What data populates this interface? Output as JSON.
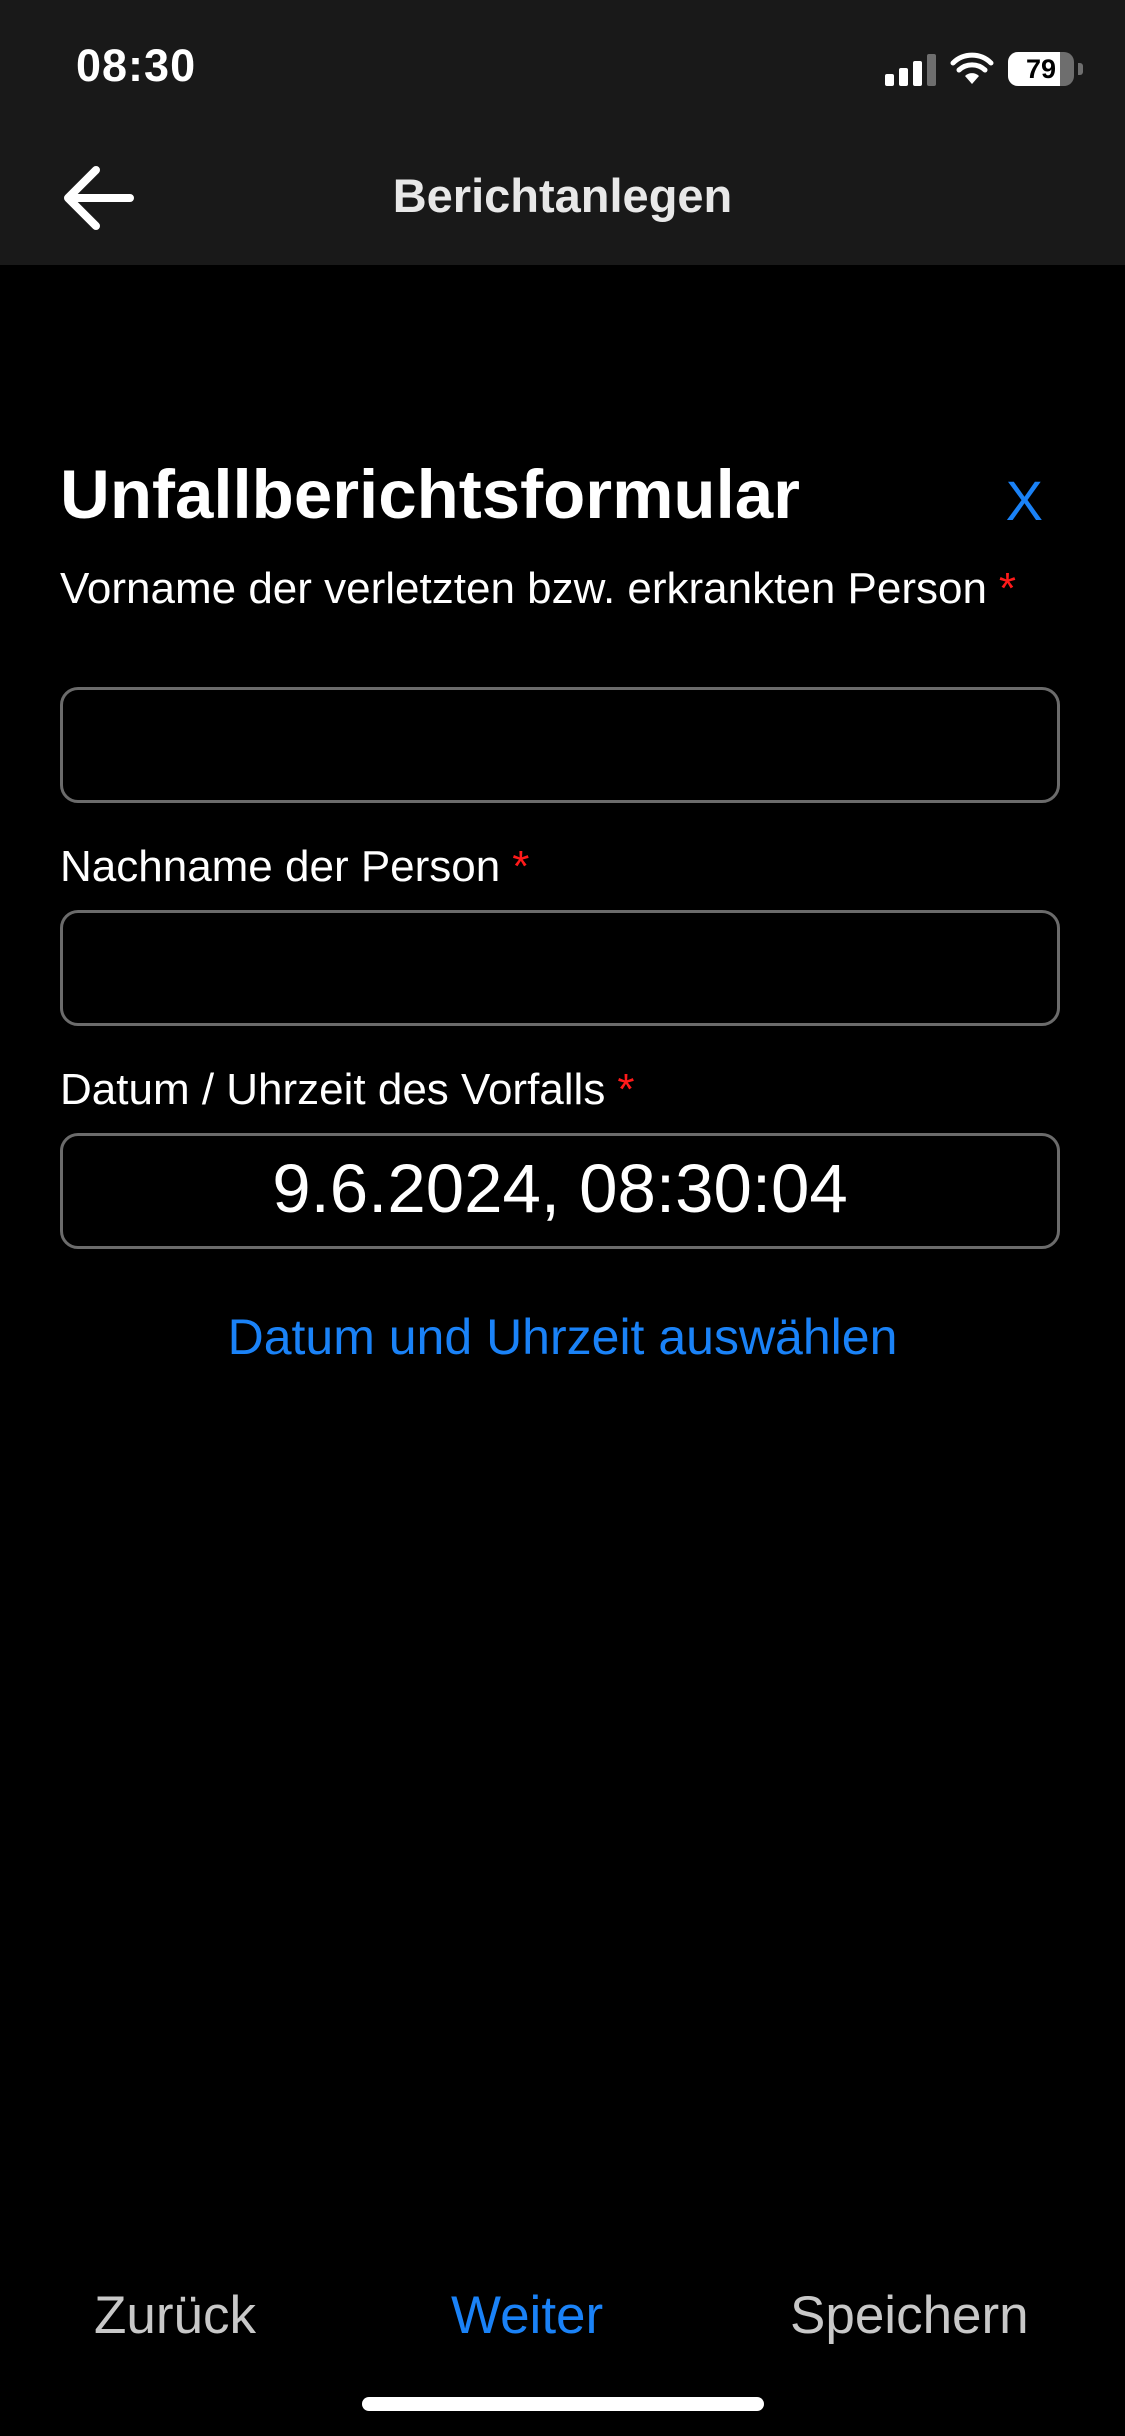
{
  "status_bar": {
    "time": "08:30",
    "battery_percent": "79",
    "battery_level": 0.79
  },
  "nav": {
    "title": "Berichtanlegen",
    "back_icon": "arrow-left-icon"
  },
  "form": {
    "title": "Unfallberichtsformular",
    "close_label": "X",
    "required_marker": "*",
    "fields": [
      {
        "label": "Vorname der verletzten bzw. erkrankten Person",
        "value": ""
      },
      {
        "label": "Nachname der Person",
        "value": ""
      },
      {
        "label": "Datum / Uhrzeit des Vorfalls",
        "value": "9.6.2024, 08:30:04"
      }
    ],
    "datetime_link": "Datum und Uhrzeit auswählen"
  },
  "bottom_bar": {
    "back_label": "Zurück",
    "next_label": "Weiter",
    "save_label": "Speichern"
  },
  "colors": {
    "accent": "#1a82f7",
    "required": "#ff1a1a",
    "header_background": "#191919",
    "background": "#000000"
  }
}
